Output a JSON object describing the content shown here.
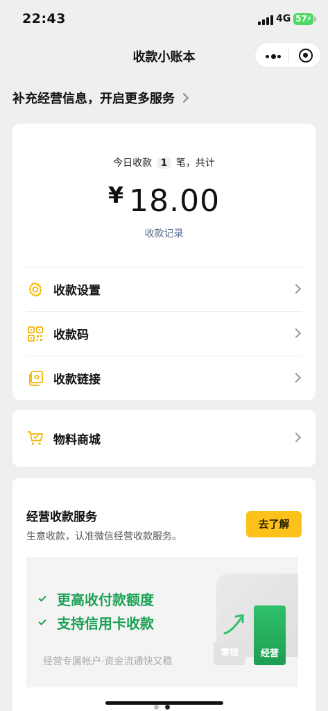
{
  "status": {
    "time": "22:43",
    "network": "4G",
    "battery": "57"
  },
  "nav": {
    "title": "收款小账本"
  },
  "promo": {
    "text": "补充经营信息，开启更多服务"
  },
  "summary": {
    "prefix": "今日收款",
    "count": "1",
    "suffix": "笔，共计",
    "currency": "¥",
    "amount": "18.00",
    "records_link": "收款记录"
  },
  "menu": [
    {
      "label": "收款设置",
      "icon": "gear-icon"
    },
    {
      "label": "收款码",
      "icon": "qrcode-icon"
    },
    {
      "label": "收款链接",
      "icon": "link-icon"
    }
  ],
  "shop": {
    "label": "物料商城",
    "icon": "cart-icon"
  },
  "service": {
    "title": "经营收款服务",
    "subtitle": "生意收款，认准微信经营收款服务。",
    "button": "去了解",
    "features": [
      "更高收付款额度",
      "支持信用卡收款"
    ],
    "tagline": "经营专属帐户·资金流通快又稳",
    "chip_small": "零钱",
    "chip_big": "经营"
  },
  "colors": {
    "accent": "#fcc21b",
    "icon": "#f0b400",
    "green": "#1aa154",
    "link": "#52678f"
  }
}
